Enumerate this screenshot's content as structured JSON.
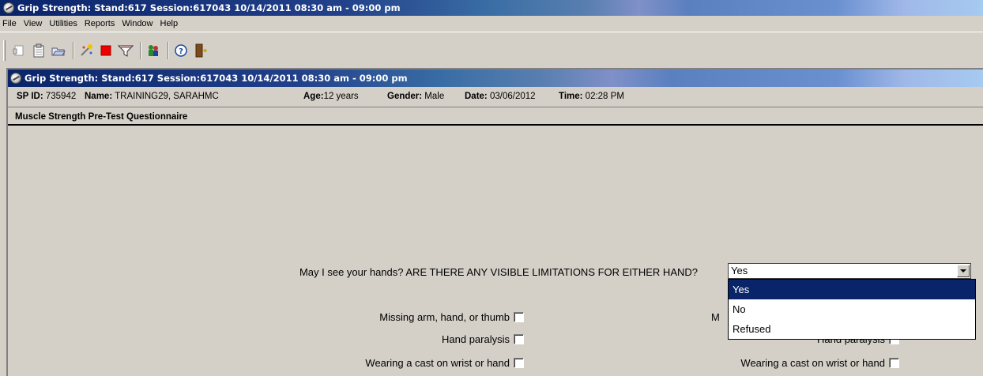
{
  "app": {
    "title": "Grip Strength: Stand:617 Session:617043 10/14/2011 08:30 am - 09:00 pm"
  },
  "menu": [
    "File",
    "View",
    "Utilities",
    "Reports",
    "Window",
    "Help"
  ],
  "toolbar": {
    "icons": [
      "new-doc-icon",
      "clipboard-icon",
      "folder-open-icon",
      "wand-icon",
      "stop-icon",
      "filter-icon",
      "people-icon",
      "help-icon",
      "exit-door-icon"
    ]
  },
  "document": {
    "title": "Grip Strength: Stand:617 Session:617043 10/14/2011 08:30 am - 09:00 pm",
    "info": {
      "sp_id_label": "SP ID:",
      "sp_id": "735942",
      "name_label": "Name:",
      "name": "TRAINING29, SARAHMC",
      "age_label": "Age:",
      "age": "12 years",
      "gender_label": "Gender:",
      "gender": "Male",
      "date_label": "Date:",
      "date": "03/06/2012",
      "time_label": "Time:",
      "time": "02:28 PM"
    },
    "section_title": "Muscle Strength Pre-Test Questionnaire",
    "question": {
      "label": "May I see your hands? ARE THERE ANY VISIBLE LIMITATIONS FOR EITHER HAND?",
      "selected": "Yes",
      "options": [
        "Yes",
        "No",
        "Refused"
      ]
    },
    "left_checkboxes": [
      {
        "label": "Missing arm, hand, or thumb",
        "checked": false
      },
      {
        "label": "Hand paralysis",
        "checked": false
      },
      {
        "label": "Wearing a cast on wrist or hand",
        "checked": false
      }
    ],
    "right_checkboxes": [
      {
        "label": "M",
        "checked": false
      },
      {
        "label": "Hand paralysis",
        "checked": false
      },
      {
        "label": "Wearing a cast on wrist or hand",
        "checked": false
      }
    ]
  },
  "colors": {
    "title_dark": "#0a246a",
    "selection": "#0a246a",
    "window_bg": "#d4d0c8"
  }
}
